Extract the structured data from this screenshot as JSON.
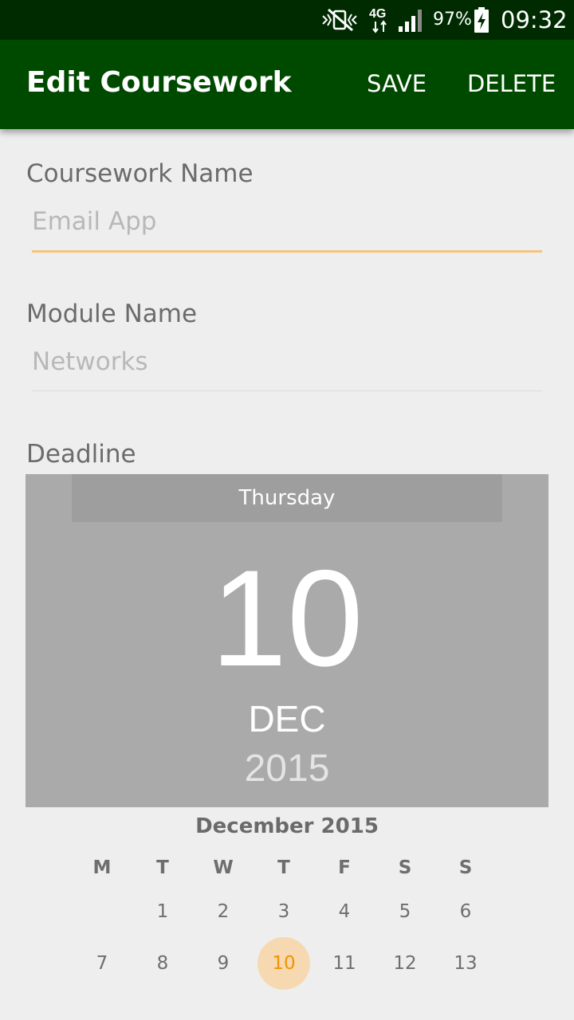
{
  "status_bar": {
    "battery": "97%",
    "network": "4G",
    "time": "09:32",
    "icons": [
      "vibrate-mute-icon",
      "network-4g-icon",
      "signal-icon",
      "battery-charging-icon"
    ]
  },
  "app_bar": {
    "title": "Edit Coursework",
    "save_label": "SAVE",
    "delete_label": "DELETE",
    "color": "#004a00"
  },
  "form": {
    "coursework": {
      "label": "Coursework Name",
      "placeholder": "Email App",
      "value": ""
    },
    "module": {
      "label": "Module Name",
      "placeholder": "Networks",
      "value": ""
    },
    "deadline": {
      "label": "Deadline"
    }
  },
  "date_picker": {
    "day_of_week": "Thursday",
    "day": "10",
    "month": "DEC",
    "year": "2015",
    "month_title": "December 2015",
    "weekday_headers": [
      "M",
      "T",
      "W",
      "T",
      "F",
      "S",
      "S"
    ],
    "weeks": [
      [
        "",
        "1",
        "2",
        "3",
        "4",
        "5",
        "6"
      ],
      [
        "7",
        "8",
        "9",
        "10",
        "11",
        "12",
        "13"
      ]
    ],
    "selected_day": "10",
    "accent_color": "#f39200"
  }
}
